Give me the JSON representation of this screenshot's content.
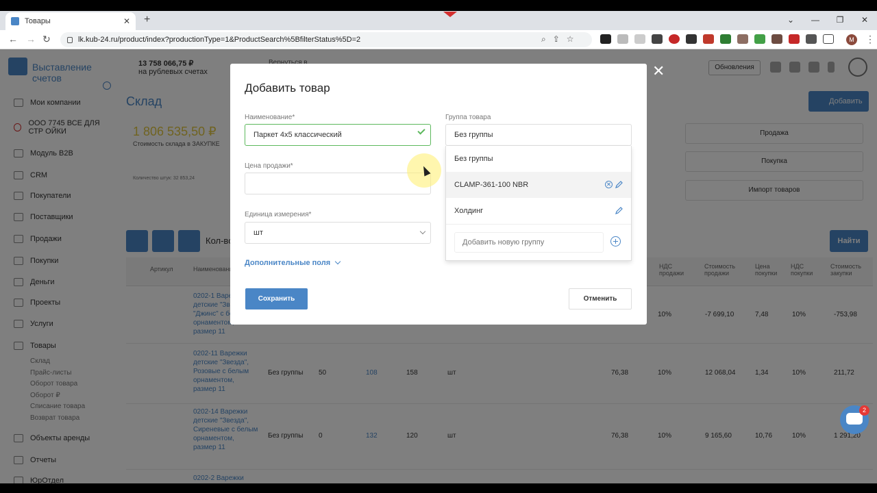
{
  "browser": {
    "tab_title": "Товары",
    "tab_close": "✕",
    "new_tab": "+",
    "url": "lk.kub-24.ru/product/index?productionType=1&ProductSearch%5BfilterStatus%5D=2",
    "profile_initial": "M",
    "window_controls": [
      "⌄",
      "—",
      "❐",
      "✕"
    ]
  },
  "app": {
    "brand": "Выставление счетов",
    "balance": "13 758 066,75 ₽",
    "balance_label": "на рублевых счетах",
    "header_hint": "Вернуться в",
    "updates_button": "Обновления",
    "page_title": "Склад",
    "add_button": "Добавить",
    "find_button": "Найти",
    "kol_label": "Кол-во",
    "stat": {
      "amount": "1 806 535,50 ₽",
      "label": "Стоимость склада в ЗАКУПКЕ",
      "count": "Количество штук: 32 853,24"
    },
    "right_selects": [
      "Продажа",
      "Покупка",
      "Импорт товаров"
    ]
  },
  "sidebar": {
    "items": [
      {
        "label": "Мои компании"
      },
      {
        "label": "ООО 7745 ВСЕ ДЛЯ СТР ОЙКИ"
      },
      {
        "label": "Модуль B2B"
      },
      {
        "label": "CRM"
      },
      {
        "label": "Покупатели"
      },
      {
        "label": "Поставщики"
      },
      {
        "label": "Продажи"
      },
      {
        "label": "Покупки"
      },
      {
        "label": "Деньги"
      },
      {
        "label": "Проекты"
      },
      {
        "label": "Услуги"
      },
      {
        "label": "Товары"
      }
    ],
    "submenu": [
      "Склад",
      "Прайс-листы",
      "Оборот товара",
      "Оборот ₽",
      "Списание товара",
      "Возврат товара"
    ],
    "after": [
      "Объекты аренды",
      "Отчеты",
      "ЮрОтдел"
    ]
  },
  "table": {
    "headers": [
      "Артикул",
      "Наименование",
      "НДС продажи",
      "Стоимость продажи",
      "Цена покупки",
      "НДС покупки",
      "Стоимость закупки"
    ],
    "rows": [
      {
        "name": "0202-1 Варежки детские \"Звезда\", \"Джинс\" с белым орнаментом, размер 11",
        "group": "",
        "v1": "",
        "v2": "",
        "v3": "",
        "unit": "",
        "price": "",
        "nds": "10%",
        "sale": "-7 699,10",
        "buy": "7,48",
        "nds2": "10%",
        "cost": "-753,98"
      },
      {
        "name": "0202-11 Варежки детские \"Звезда\", Розовые с белым орнаментом, размер 11",
        "group": "Без группы",
        "v1": "50",
        "v2": "108",
        "v3": "158",
        "unit": "шт",
        "price": "76,38",
        "nds": "10%",
        "sale": "12 068,04",
        "buy": "1,34",
        "nds2": "10%",
        "cost": "211,72"
      },
      {
        "name": "0202-14 Варежки детские \"Звезда\", Сиреневые с белым орнаментом, размер 11",
        "group": "Без группы",
        "v1": "0",
        "v2": "132",
        "v3": "120",
        "unit": "шт",
        "price": "76,38",
        "nds": "10%",
        "sale": "9 165,60",
        "buy": "10,76",
        "nds2": "10%",
        "cost": "1 291,20"
      },
      {
        "name": "0202-2 Варежки",
        "group": "",
        "v1": "",
        "v2": "",
        "v3": "",
        "unit": "",
        "price": "",
        "nds": "",
        "sale": "",
        "buy": "",
        "nds2": "",
        "cost": ""
      }
    ]
  },
  "modal": {
    "title": "Добавить товар",
    "close": "✕",
    "name_label": "Наименование*",
    "name_value": "Паркет 4х5 классический",
    "price_label": "Цена продажи*",
    "price_value": "",
    "unit_label": "Единица измерения*",
    "unit_value": "шт",
    "group_label": "Группа товара",
    "group_value": "Без группы",
    "extra_fields": "Дополнительные поля",
    "save": "Сохранить",
    "cancel": "Отменить",
    "dropdown": {
      "options": [
        "Без группы",
        "CLAMP-361-100 NBR",
        "Холдинг"
      ],
      "new_group_placeholder": "Добавить новую группу"
    }
  },
  "chat": {
    "badge": "2"
  },
  "colors": {
    "accent": "#4a86c6",
    "success": "#5cb85c",
    "amount": "#e0c640"
  }
}
